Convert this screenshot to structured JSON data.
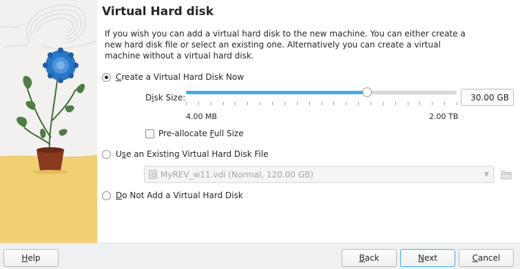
{
  "page": {
    "title": "Virtual Hard disk",
    "description": "If you wish you can add a virtual hard disk to the new machine. You can either create a new hard disk file or select an existing one. Alternatively you can create a virtual machine without a virtual hard disk."
  },
  "options": {
    "create_new": {
      "prefix": "",
      "mnemonic": "C",
      "rest": "reate a Virtual Hard Disk Now",
      "checked": true
    },
    "use_existing": {
      "prefix": "U",
      "mnemonic": "s",
      "rest": "e an Existing Virtual Hard Disk File",
      "checked": false
    },
    "no_disk": {
      "prefix": "",
      "mnemonic": "D",
      "rest": "o Not Add a Virtual Hard Disk",
      "checked": false
    }
  },
  "disk_size": {
    "label_prefix": "D",
    "label_mnemonic": "i",
    "label_rest": "sk Size:",
    "value": "30.00 GB",
    "min_label": "4.00 MB",
    "max_label": "2.00 TB",
    "slider_fraction": 0.67
  },
  "preallocate": {
    "prefix": "Pre-allocate ",
    "mnemonic": "F",
    "rest": "ull Size",
    "checked": false
  },
  "existing_file": {
    "selected": "MyREV_w11.vdi (Normal, 120.00 GB)",
    "enabled": false
  },
  "buttons": {
    "help": {
      "mnemonic": "H",
      "rest": "elp"
    },
    "back": {
      "mnemonic": "B",
      "rest": "ack"
    },
    "next": {
      "mnemonic": "N",
      "rest": "ext"
    },
    "cancel": {
      "prefix": "",
      "mnemonic": "C",
      "rest": "ancel"
    }
  },
  "icons": {
    "illustration": "flower-pot-illustration",
    "disk": "hard-disk-icon",
    "folder": "folder-open-icon"
  },
  "colors": {
    "accent": "#3daee9",
    "flower": "#2a76c6",
    "pot": "#8b3a22",
    "floor": "#f1cf73"
  }
}
